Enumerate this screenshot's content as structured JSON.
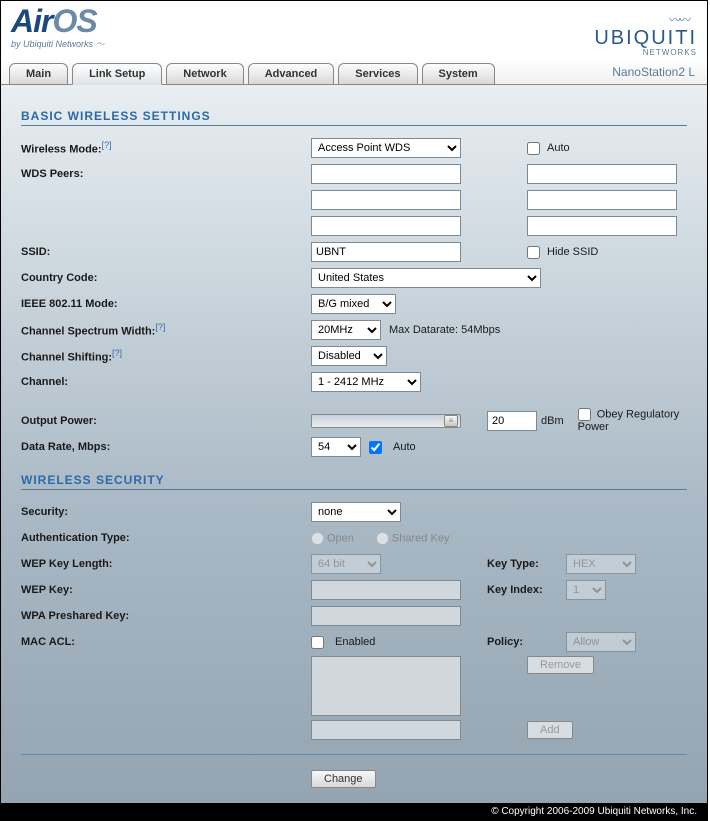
{
  "header": {
    "logo_air": "Air",
    "logo_os": "OS",
    "logo_sub": "by Ubiquiti Networks",
    "ubiquiti": "UBIQUITI",
    "ubiquiti_sub": "NETWORKS",
    "device": "NanoStation2 L"
  },
  "tabs": [
    "Main",
    "Link Setup",
    "Network",
    "Advanced",
    "Services",
    "System"
  ],
  "active_tab": 1,
  "sections": {
    "basic": "BASIC WIRELESS SETTINGS",
    "security": "WIRELESS SECURITY"
  },
  "labels": {
    "wireless_mode": "Wireless Mode:",
    "wds_peers": "WDS Peers:",
    "ssid": "SSID:",
    "country": "Country Code:",
    "ieee": "IEEE 802.11 Mode:",
    "spectrum": "Channel Spectrum Width:",
    "shifting": "Channel Shifting:",
    "channel": "Channel:",
    "output_power": "Output Power:",
    "data_rate": "Data Rate, Mbps:",
    "security": "Security:",
    "auth_type": "Authentication Type:",
    "wep_length": "WEP Key Length:",
    "wep_key": "WEP Key:",
    "wpa_psk": "WPA Preshared Key:",
    "mac_acl": "MAC ACL:",
    "auto": "Auto",
    "hide_ssid": "Hide SSID",
    "max_datarate": "Max Datarate: 54Mbps",
    "dbm": "dBm",
    "obey": "Obey Regulatory Power",
    "open": "Open",
    "shared": "Shared Key",
    "key_type": "Key Type:",
    "key_index": "Key Index:",
    "enabled": "Enabled",
    "policy": "Policy:",
    "remove": "Remove",
    "add": "Add",
    "change": "Change",
    "help": "[?]"
  },
  "values": {
    "wireless_mode": "Access Point WDS",
    "ssid": "UBNT",
    "country": "United States",
    "ieee": "B/G mixed",
    "spectrum": "20MHz",
    "shifting": "Disabled",
    "channel": "1 - 2412 MHz",
    "output_power": "20",
    "data_rate": "54",
    "security": "none",
    "wep_length": "64 bit",
    "key_type": "HEX",
    "key_index": "1",
    "policy": "Allow",
    "data_rate_auto": true,
    "wds_peers": [
      "",
      "",
      "",
      "",
      "",
      ""
    ]
  },
  "footer": "© Copyright 2006-2009 Ubiquiti Networks, Inc."
}
